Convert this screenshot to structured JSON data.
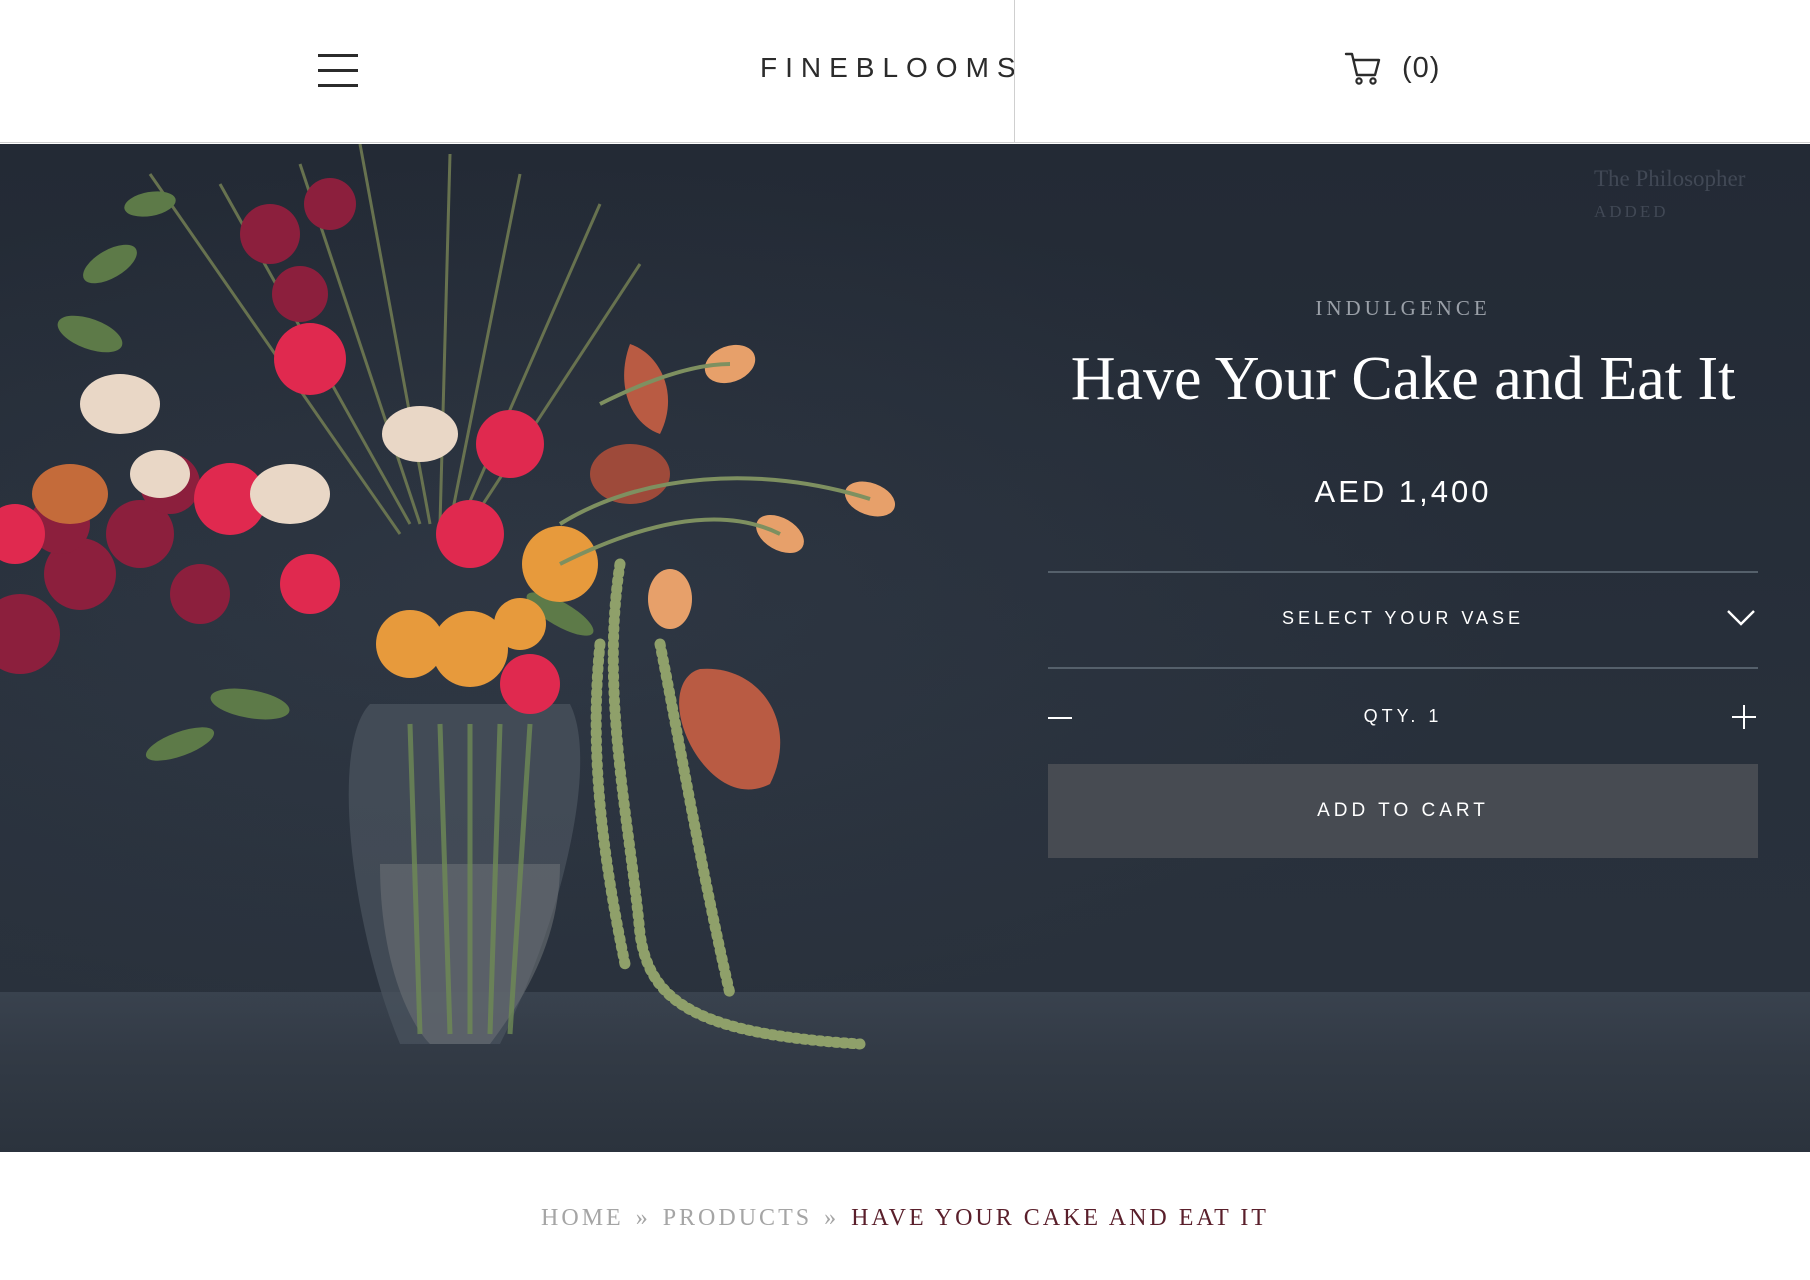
{
  "header": {
    "logo": "FINEBLOOMS",
    "cart_count": "(0)"
  },
  "toast": {
    "title": "The Philosopher",
    "status": "ADDED"
  },
  "product": {
    "category": "INDULGENCE",
    "title": "Have Your Cake and Eat It",
    "price": "AED 1,400",
    "vase_select_label": "SELECT YOUR VASE",
    "quantity_label": "QTY. 1",
    "add_to_cart_label": "ADD TO CART"
  },
  "breadcrumb": {
    "home": "HOME",
    "products": "PRODUCTS",
    "separator": "»",
    "current": "HAVE YOUR CAKE AND EAT IT"
  },
  "colors": {
    "hero_background": "#232a35",
    "add_to_cart_background": "#474b52",
    "breadcrumb_current": "#5a1f2b"
  },
  "icons": {
    "menu": "hamburger-icon",
    "cart": "cart-icon",
    "vase_dropdown": "chevron-down-icon",
    "decrease": "minus-icon",
    "increase": "plus-icon"
  }
}
